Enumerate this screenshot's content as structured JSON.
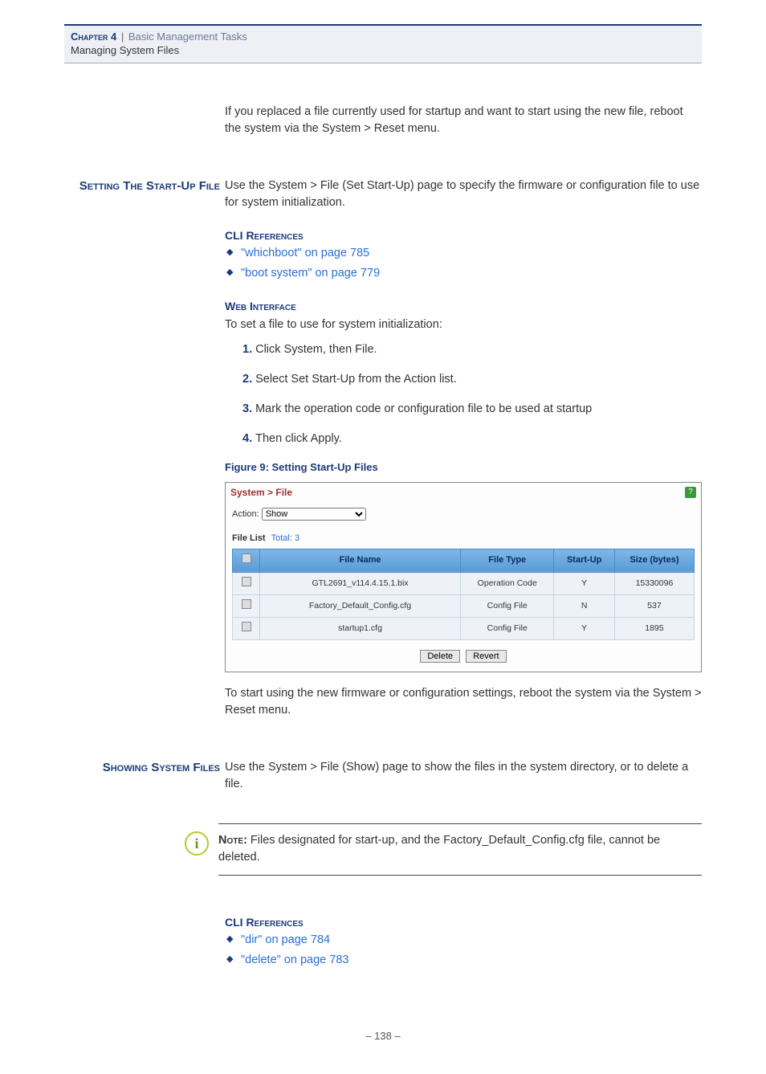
{
  "header": {
    "chapter": "Chapter 4",
    "sep": "|",
    "title": "Basic Management Tasks",
    "subtitle": "Managing System Files"
  },
  "intro_paragraph": "If you replaced a file currently used for startup and want to start using the new file, reboot the system via the System > Reset menu.",
  "section1": {
    "side_title": "Setting The Start-Up File",
    "intro": "Use the System > File (Set Start-Up) page to specify the firmware or configuration file to use for system initialization.",
    "cli_heading": "CLI References",
    "cli_links": [
      "\"whichboot\" on page 785",
      "\"boot system\" on page 779"
    ],
    "web_heading": "Web Interface",
    "web_intro": "To set a file to use for system initialization:",
    "steps": [
      "Click System, then File.",
      "Select Set Start-Up from the Action list.",
      "Mark the operation code or configuration file to be used at startup",
      "Then click Apply."
    ],
    "fig_caption": "Figure 9:  Setting Start-Up Files",
    "fig": {
      "crumb": "System > File",
      "help": "?",
      "action_label": "Action:",
      "action_value": "Show",
      "list_label": "File List",
      "list_total": "Total: 3",
      "headers": [
        "",
        "File Name",
        "File Type",
        "Start-Up",
        "Size (bytes)"
      ],
      "rows": [
        {
          "name": "GTL2691_v114.4.15.1.bix",
          "type": "Operation Code",
          "start": "Y",
          "size": "15330096"
        },
        {
          "name": "Factory_Default_Config.cfg",
          "type": "Config File",
          "start": "N",
          "size": "537"
        },
        {
          "name": "startup1.cfg",
          "type": "Config File",
          "start": "Y",
          "size": "1895"
        }
      ],
      "btn_delete": "Delete",
      "btn_revert": "Revert"
    },
    "after_fig": "To start using the new firmware or configuration settings, reboot the system via the System > Reset menu."
  },
  "section2": {
    "side_title": "Showing System Files",
    "intro": "Use the System > File (Show) page to show the files in the system directory, or to delete a file.",
    "note_label": "Note:",
    "note_text": " Files designated for start-up, and the Factory_Default_Config.cfg file, cannot be deleted.",
    "cli_heading": "CLI References",
    "cli_links": [
      "\"dir\" on page 784",
      "\"delete\" on page 783"
    ]
  },
  "page_number": "– 138 –"
}
